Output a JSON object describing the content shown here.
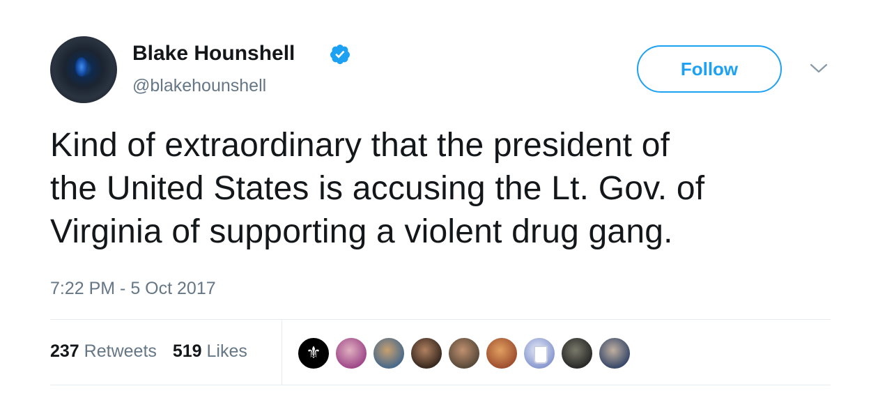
{
  "author": {
    "name": "Blake Hounshell",
    "handle": "@blakehounshell",
    "verified": true,
    "avatar_icon": "avatar-dark-eye-icon"
  },
  "actions": {
    "follow_label": "Follow",
    "menu_icon": "chevron-down-icon"
  },
  "tweet": {
    "text_lines": [
      "Kind of extraordinary that the president of",
      "the United States is accusing the Lt. Gov. of",
      "Virginia of supporting a violent drug gang."
    ],
    "timestamp": "7:22 PM - 5 Oct 2017"
  },
  "stats": {
    "retweets_count": "237",
    "retweets_label": "Retweets",
    "likes_count": "519",
    "likes_label": "Likes"
  },
  "likers": [
    {
      "icon": "fleur-de-lis-avatar",
      "colors": [
        "#000000",
        "#1a1a1a"
      ]
    },
    {
      "icon": "person-avatar",
      "colors": [
        "#a04a8a",
        "#e0b0c0"
      ]
    },
    {
      "icon": "trees-avatar",
      "colors": [
        "#4a6a8a",
        "#c8a070"
      ]
    },
    {
      "icon": "man-avatar",
      "colors": [
        "#3a2a20",
        "#b08060"
      ]
    },
    {
      "icon": "cat-avatar",
      "colors": [
        "#5a4a3a",
        "#c09070"
      ]
    },
    {
      "icon": "woman-avatar",
      "colors": [
        "#a05030",
        "#e0a060"
      ]
    },
    {
      "icon": "mug-avatar",
      "colors": [
        "#8a9ad0",
        "#e8ecf8"
      ]
    },
    {
      "icon": "group-avatar",
      "colors": [
        "#2a2a2a",
        "#7a7a6a"
      ]
    },
    {
      "icon": "people-avatar",
      "colors": [
        "#3a4a6a",
        "#c0b0a0"
      ]
    }
  ],
  "colors": {
    "accent": "#1da1f2",
    "text": "#14171a",
    "muted": "#657786",
    "divider": "#e6ecf0"
  }
}
